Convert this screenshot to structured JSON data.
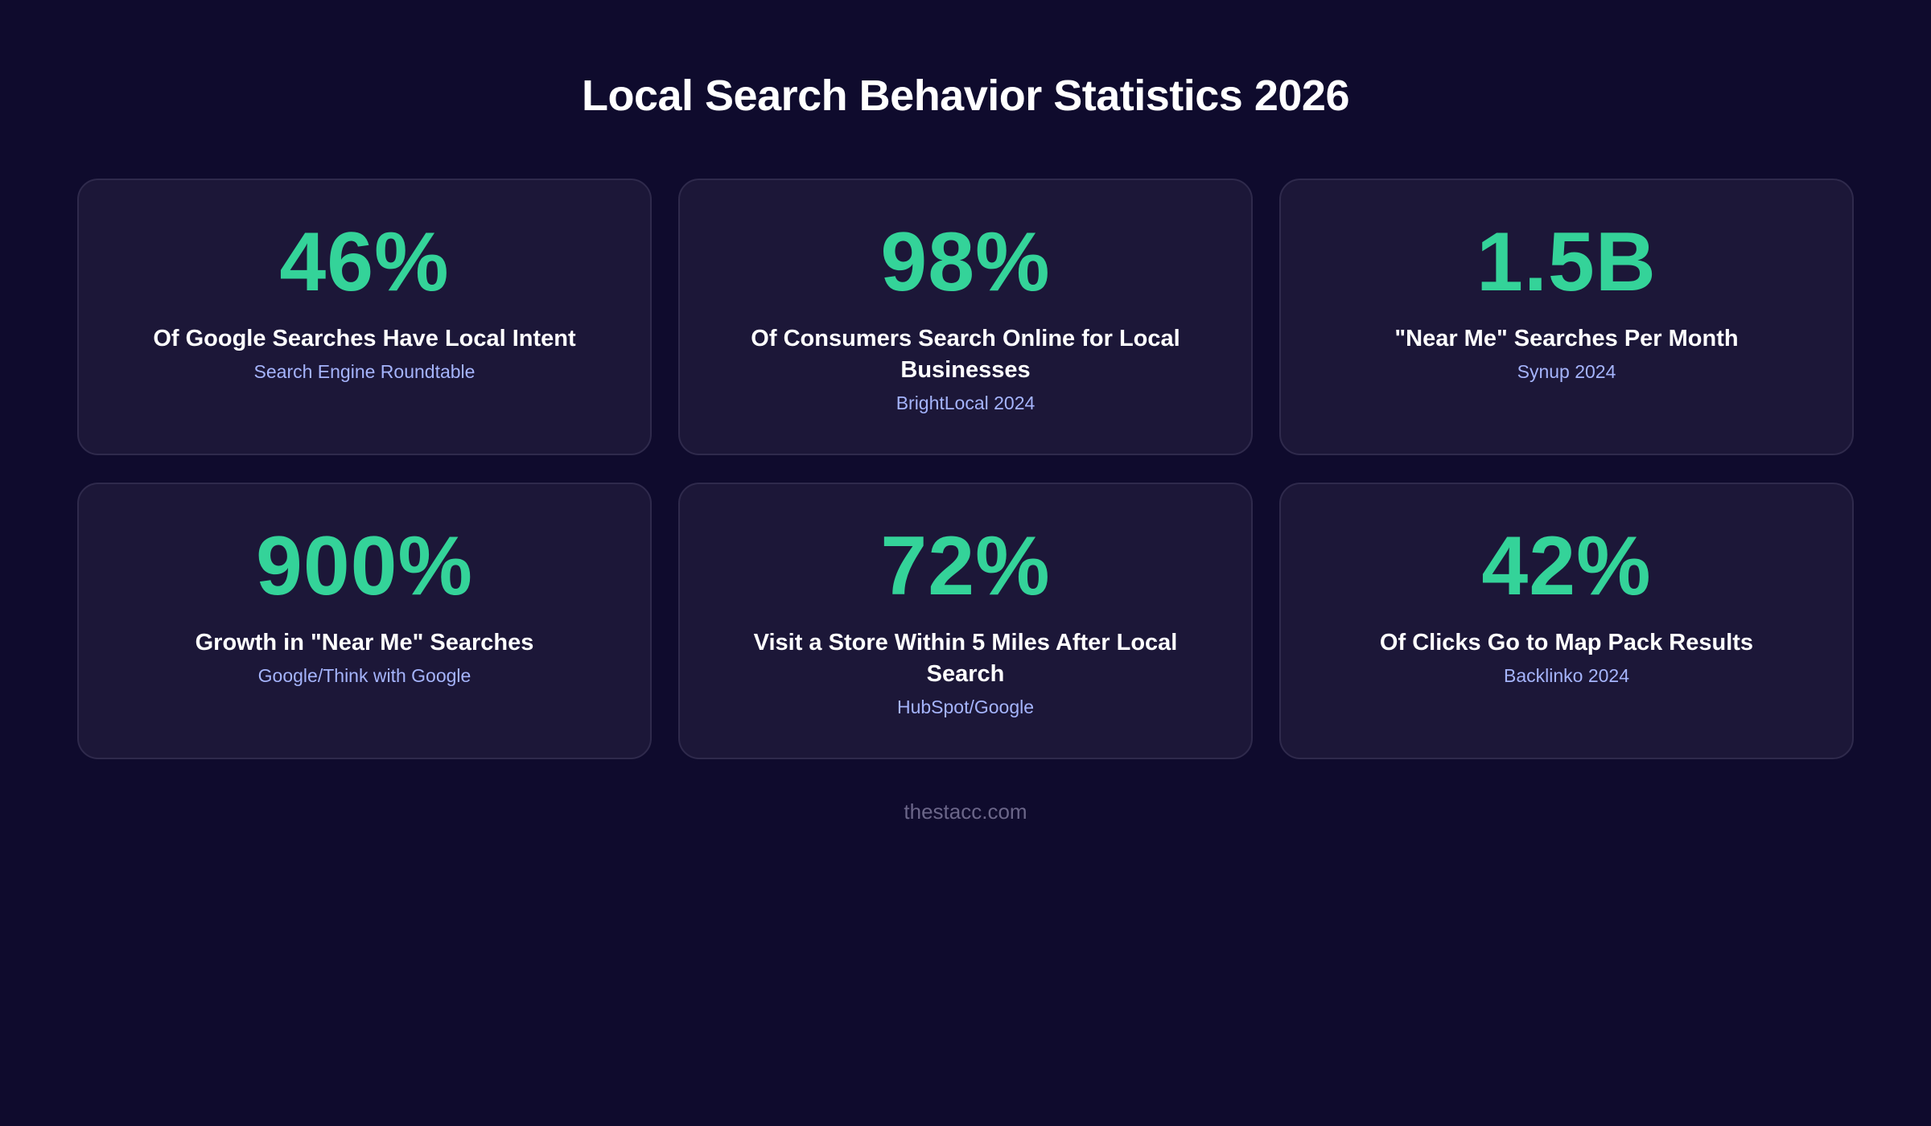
{
  "title": "Local Search Behavior Statistics 2026",
  "accent_color": "#34d399",
  "background_color": "#0f0b2d",
  "card_color": "#1c1738",
  "source_color": "#a5b4fc",
  "stats": [
    {
      "value": "46%",
      "label": "Of Google Searches Have Local Intent",
      "source": "Search Engine Roundtable"
    },
    {
      "value": "98%",
      "label": "Of Consumers Search Online for Local Businesses",
      "source": "BrightLocal 2024"
    },
    {
      "value": "1.5B",
      "label": "\"Near Me\" Searches Per Month",
      "source": "Synup 2024"
    },
    {
      "value": "900%",
      "label": "Growth in \"Near Me\" Searches",
      "source": "Google/Think with Google"
    },
    {
      "value": "72%",
      "label": "Visit a Store Within 5 Miles After Local Search",
      "source": "HubSpot/Google"
    },
    {
      "value": "42%",
      "label": "Of Clicks Go to Map Pack Results",
      "source": "Backlinko 2024"
    }
  ],
  "footer": "thestacc.com"
}
